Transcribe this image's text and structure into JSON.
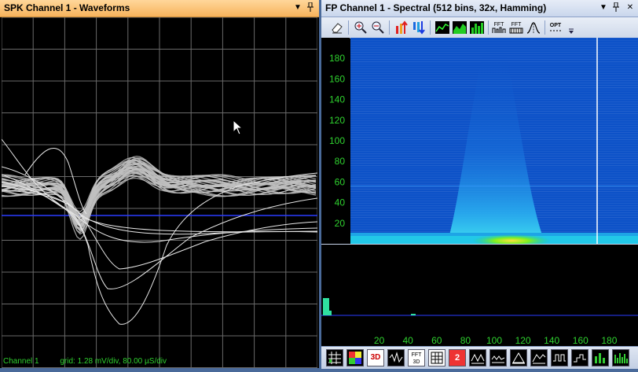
{
  "left": {
    "title": "SPK Channel 1 - Waveforms",
    "pin_icon": "pin-icon",
    "dropdown_icon": "dropdown-arrow-icon",
    "status_channel": "Channel 1",
    "status_grid": "grid: 1.28 mV/div, 80.00 µS/div"
  },
  "right": {
    "title": "FP Channel 1 - Spectral (512 bins, 32x, Hamming)",
    "y_ticks": [
      "180",
      "160",
      "140",
      "120",
      "100",
      "80",
      "60",
      "40",
      "20"
    ],
    "x_ticks": [
      "20",
      "40",
      "60",
      "80",
      "100",
      "120",
      "140",
      "160",
      "180"
    ],
    "toolbar_icons": [
      "eraser-icon",
      "zoom-in-icon",
      "zoom-out-icon",
      "sort-up-icon",
      "sort-down-icon",
      "line-graph-icon",
      "area-graph-icon",
      "bar-graph-icon",
      "fft-icon",
      "fft-bins-icon",
      "peak-icon",
      "options-icon"
    ],
    "toolbar_labels": {
      "fft1": "FFT",
      "fft2": "FFT",
      "opt": "OPT"
    },
    "bottom_labels": {
      "3d": "3D",
      "fft3d": "FFT 3D",
      "two": "2"
    }
  },
  "colors": {
    "accent_green": "#2fd22f",
    "spectrogram_bg": "#0d52c8",
    "baseline_blue": "#2a3cff",
    "waveform_gray": "#bfbfbf"
  }
}
